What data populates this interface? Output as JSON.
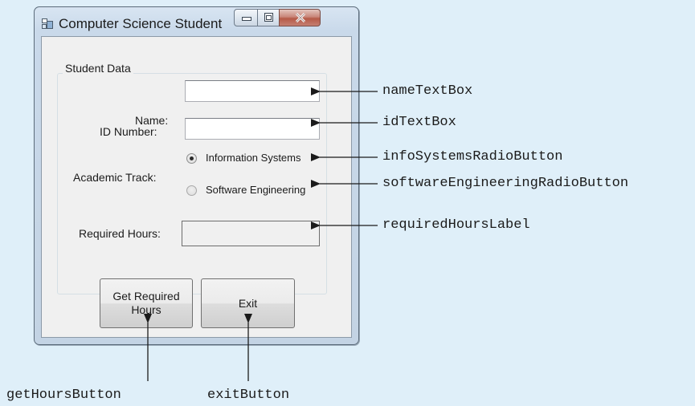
{
  "window": {
    "title": "Computer Science Student",
    "buttons": {
      "minimize": "minimize",
      "maximize": "maximize",
      "close": "close"
    }
  },
  "form": {
    "group_title": "Student Data",
    "name_label": "Name:",
    "name_value": "",
    "id_label": "ID Number:",
    "id_value": "",
    "track_label": "Academic Track:",
    "track_options": [
      {
        "label": "Information Systems",
        "selected": true
      },
      {
        "label": "Software Engineering",
        "selected": false
      }
    ],
    "hours_label": "Required Hours:",
    "hours_value": "",
    "get_hours_button": "Get Required\nHours",
    "exit_button": "Exit"
  },
  "callouts": {
    "name": "nameTextBox",
    "id": "idTextBox",
    "info": "infoSystemsRadioButton",
    "software": "softwareEngineeringRadioButton",
    "hours": "requiredHoursLabel",
    "get_hours": "getHoursButton",
    "exit": "exitButton"
  },
  "colors": {
    "background": "#dfeff9",
    "callout_line": "#1b1b1b"
  }
}
